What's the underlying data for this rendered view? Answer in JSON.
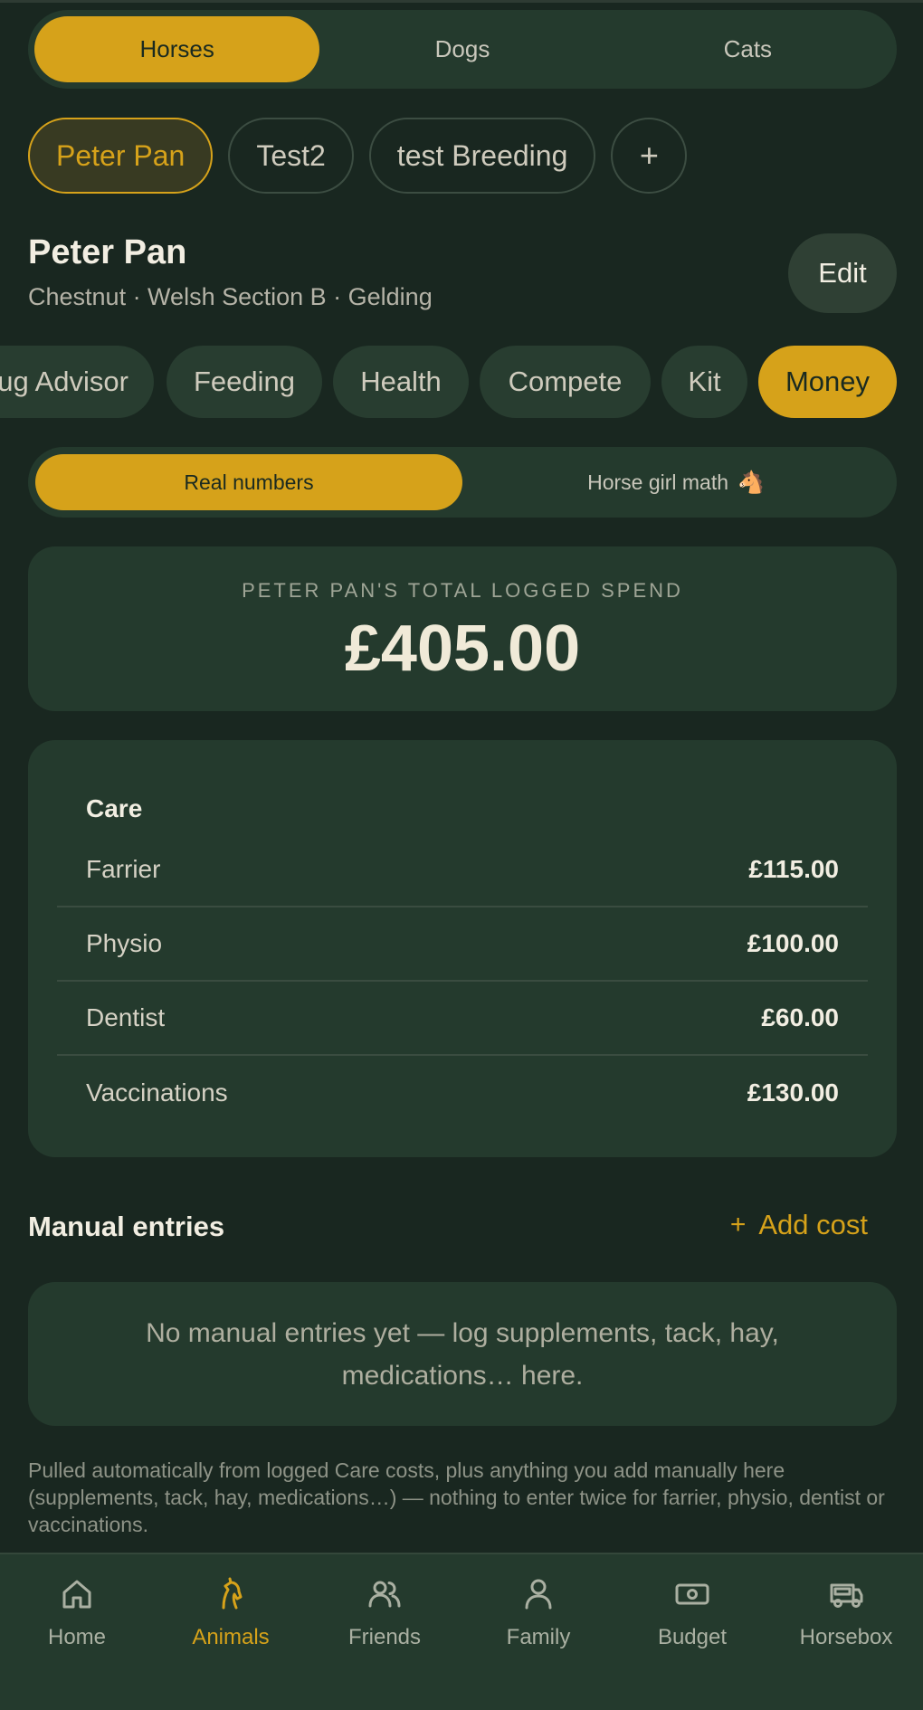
{
  "species_tabs": [
    "Horses",
    "Dogs",
    "Cats"
  ],
  "species_active": "Horses",
  "horses": [
    "Peter Pan",
    "Test2",
    "test Breeding"
  ],
  "add_horse_icon": "+",
  "horse": {
    "name": "Peter Pan",
    "details": "Chestnut · Welsh Section B · Gelding",
    "edit_label": "Edit"
  },
  "section_tabs": [
    "ug Advisor",
    "Feeding",
    "Health",
    "Compete",
    "Kit",
    "Money"
  ],
  "section_active": "Money",
  "mode": {
    "real": "Real numbers",
    "math": "Horse girl math",
    "math_emoji": "🐴"
  },
  "total": {
    "label": "PETER PAN'S TOTAL LOGGED SPEND",
    "value": "£405.00"
  },
  "care": {
    "title": "Care",
    "rows": [
      {
        "label": "Farrier",
        "amount": "£115.00"
      },
      {
        "label": "Physio",
        "amount": "£100.00"
      },
      {
        "label": "Dentist",
        "amount": "£60.00"
      },
      {
        "label": "Vaccinations",
        "amount": "£130.00"
      }
    ]
  },
  "manual": {
    "title": "Manual entries",
    "add_label": "Add cost",
    "add_icon": "+",
    "empty": "No manual entries yet — log supplements, tack, hay, medications… here."
  },
  "footnote": "Pulled automatically from logged Care costs, plus anything you add manually here (supplements, tack, hay, medications…) — nothing to enter twice for farrier, physio, dentist or vaccinations.",
  "nav": [
    {
      "label": "Home",
      "icon": "home-icon"
    },
    {
      "label": "Animals",
      "icon": "horse-icon"
    },
    {
      "label": "Friends",
      "icon": "friends-icon"
    },
    {
      "label": "Family",
      "icon": "person-icon"
    },
    {
      "label": "Budget",
      "icon": "money-icon"
    },
    {
      "label": "Horsebox",
      "icon": "horsebox-icon"
    }
  ],
  "nav_active": "Animals",
  "colors": {
    "background": "#192720",
    "card": "#243a2d",
    "accent": "#d6a21a"
  }
}
